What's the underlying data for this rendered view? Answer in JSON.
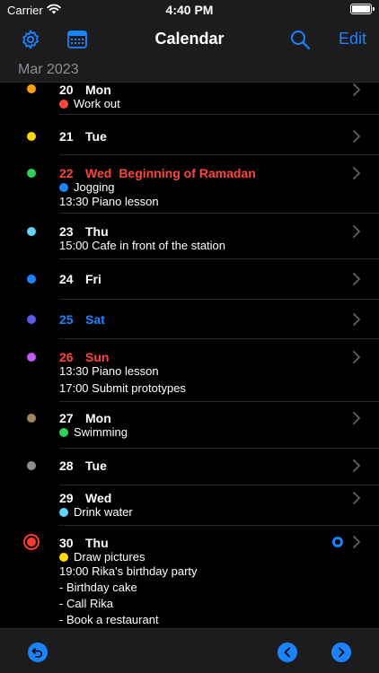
{
  "status_bar": {
    "carrier": "Carrier",
    "time": "4:40 PM"
  },
  "nav": {
    "title": "Calendar",
    "edit_label": "Edit"
  },
  "month_header": "Mar 2023",
  "colors": {
    "accent": "#1a84ff",
    "red": "#ff453a",
    "bg": "#000000",
    "bar": "#1c1c1e"
  },
  "days": [
    {
      "day": "20",
      "dow": "Mon",
      "dot": "#ff9f0a",
      "events": [
        {
          "dot": "#ff453a",
          "text": "Work out"
        }
      ]
    },
    {
      "day": "21",
      "dow": "Tue",
      "dot": "#ffd60a",
      "events": []
    },
    {
      "day": "22",
      "dow": "Wed",
      "holiday": "Beginning of Ramadan",
      "dot": "#30d158",
      "events": [
        {
          "dot": "#1a84ff",
          "text": "Jogging"
        },
        {
          "text": "13:30 Piano lesson"
        }
      ]
    },
    {
      "day": "23",
      "dow": "Thu",
      "dot": "#64d2ff",
      "events": [
        {
          "text": "15:00 Cafe in front of the station"
        }
      ]
    },
    {
      "day": "24",
      "dow": "Fri",
      "dot": "#1a84ff",
      "events": []
    },
    {
      "day": "25",
      "dow": "Sat",
      "dot": "#5e5ce6",
      "events": []
    },
    {
      "day": "26",
      "dow": "Sun",
      "dot": "#bf5af2",
      "events": [
        {
          "text": "13:30 Piano lesson"
        },
        {
          "text": "17:00 Submit prototypes"
        }
      ]
    },
    {
      "day": "27",
      "dow": "Mon",
      "dot": "#a2845e",
      "events": [
        {
          "dot": "#30d158",
          "text": "Swimming"
        }
      ]
    },
    {
      "day": "28",
      "dow": "Tue",
      "dot": "#8e8e93",
      "events": []
    },
    {
      "day": "29",
      "dow": "Wed",
      "events": [
        {
          "dot": "#64d2ff",
          "text": "Drink water"
        }
      ]
    },
    {
      "day": "30",
      "dow": "Thu",
      "today": true,
      "events": [
        {
          "dot": "#ffd60a",
          "text": "Draw pictures"
        },
        {
          "text": "19:00 Rika's birthday party"
        },
        {
          "text": "- Birthday cake"
        },
        {
          "text": "- Call Rika"
        },
        {
          "text": "- Book a restaurant"
        }
      ]
    }
  ],
  "icons": {
    "settings": "gear-icon",
    "calendar": "calendar-grid-icon",
    "search": "search-icon",
    "undo": "undo-arrow-icon",
    "prev": "chevron-left-circle-icon",
    "next": "chevron-right-circle-icon"
  }
}
